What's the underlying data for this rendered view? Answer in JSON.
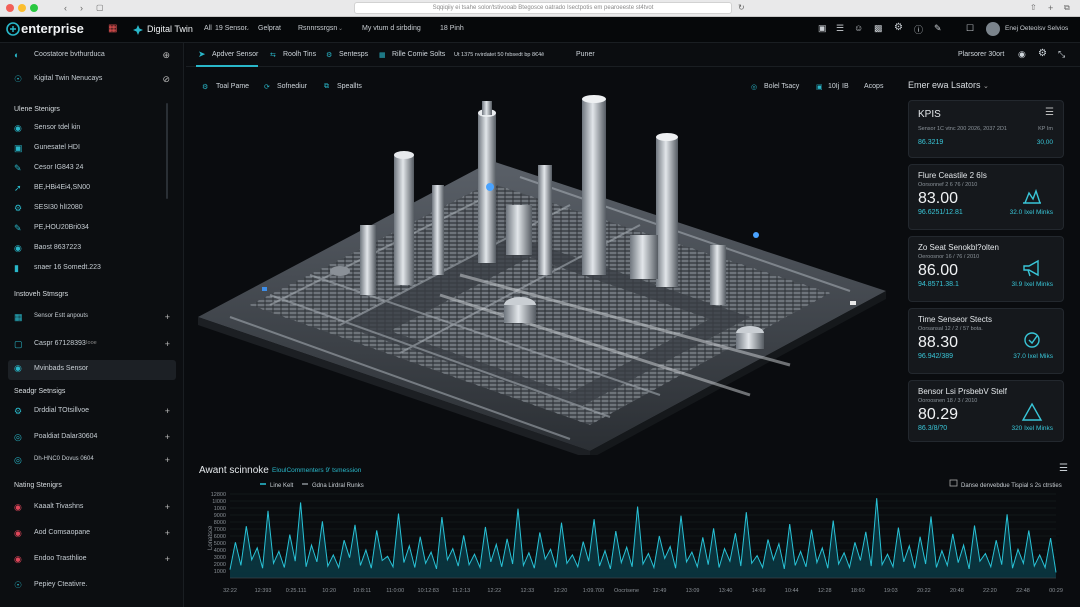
{
  "browser": {
    "url": "Sqqiqiiy ei tsahe solor/tstivooab Btegosce oatrado Isectpotis em pearoeeste st4tvot",
    "colors": {
      "close": "#f25f58",
      "min": "#fbbe2e",
      "max": "#29c840"
    }
  },
  "topbar": {
    "brand": "enterprise",
    "app_title": "Digital Twin",
    "menu": [
      "All",
      "19 Sensor",
      "Gelprat",
      "Rsnnrssrgsn",
      "My vtum d sirbding",
      "18 Pinh"
    ],
    "user_name": "Enej Oeteolsv Selvios",
    "icons": [
      "grid-icon",
      "camera-icon",
      "people-icon",
      "bag-icon",
      "gear-icon",
      "help-icon",
      "bell-icon",
      "layers-icon"
    ]
  },
  "sidebar": {
    "top_items": [
      {
        "label": "Coostatore bvthurduca"
      },
      {
        "label": "Kigital Twin Nenucays"
      }
    ],
    "section1_title": "Ulene Stenigrs",
    "section1_items": [
      {
        "label": "Sensor tdel kin"
      },
      {
        "label": "Gunesatel HDI"
      },
      {
        "label": "Cesor IG843 24"
      },
      {
        "label": "BE,HBi4Ei4,SN00"
      },
      {
        "label": "SESI30 hlI2080"
      },
      {
        "label": "PE,HOU20Bri034"
      },
      {
        "label": "Baost 8637223"
      },
      {
        "label": "snaer 16 Somedt.223"
      }
    ],
    "section2_title": "Instoveh Stmsgrs",
    "section2_items": [
      {
        "label": "Sensor Estt anpouts"
      },
      {
        "label": "Caspr 67128393",
        "tag": "Iooe"
      },
      {
        "label": "Mvinbads Sensor"
      }
    ],
    "section3_title": "Seadgr Setnsigs",
    "section3_items": [
      {
        "label": "Drddial TOtsillvoe"
      },
      {
        "label": "Poaldiat Dalar30604"
      },
      {
        "label": "Dh-HNC0 Dovus 0604"
      }
    ],
    "section4_title": "Nating Stenigrs",
    "section4_items": [
      {
        "label": "Kaaalt Tivashns"
      },
      {
        "label": "Aod Comsaopane"
      },
      {
        "label": "Endoo Trasthlioe"
      },
      {
        "label": "Pepiey Cteativre."
      }
    ]
  },
  "secbar": {
    "items": [
      "Apdver Sensor",
      "Roolh Tins",
      "Sentesps",
      "Rille Comie Solts",
      "Ut 1375 nvirdatet 50 fxbsedt bp 8€4ê",
      "Puner"
    ],
    "right_label": "Plarsorer 30ort"
  },
  "view": {
    "tools": [
      "Toal Pame",
      "Sofnediur",
      "Speallts"
    ],
    "right_tools": [
      "Bolel Tsacy",
      "10Ij",
      "IB",
      "Acops"
    ]
  },
  "right_panel": {
    "header": "Emer ewa Lsators",
    "kpis": {
      "title": "KPIS",
      "subtitle": "Sensor 1C vtnc 200 2026, 2037 2D1",
      "subtitle_right": "KP Im",
      "value": "86.3219",
      "value_right": "30,00"
    },
    "cards": [
      {
        "title": "Flure Ceastile 2 6Is",
        "subtitle": "Oorsonnef 2 6 76 / 2010",
        "value": "83.00",
        "sub": "96.6251/12.81",
        "right": "32.0 Ixel Minks",
        "icon": "plant-icon"
      },
      {
        "title": "Zo Seat Senokbl?olten",
        "subtitle": "Oeroosnor 16 / 76 / 2010",
        "value": "86.00",
        "sub": "94.8571.38.1",
        "right": "3I.9 Ixel Minks",
        "icon": "megaphone-icon"
      },
      {
        "title": "Time Senseor Stects",
        "subtitle": "Oorsansal 12 / 2 / 57 bota.",
        "value": "88.30",
        "sub": "96.942/389",
        "right": "37.0 Ixel Miks",
        "icon": "target-icon"
      },
      {
        "title": "Bensor Lsi PrsbebV Stelf",
        "subtitle": "Ooroosnen 18 / 3 / 2010",
        "value": "80.29",
        "sub": "86.3/8/?0",
        "right": "320 Ixel Minks",
        "icon": "alert-triangle-icon"
      }
    ]
  },
  "chart": {
    "title": "Awant scinnoke",
    "subtitle": "EloulCommenters 9' tsmession",
    "legend": [
      "Line Kelt",
      "Gdna Lirdral Runks"
    ],
    "right_label": "Danse denvebdue Tispial s 2s ctrsties",
    "ylabel": "Lonatsce",
    "colors": {
      "line": "#28c2d6",
      "fill": "#0b3a44",
      "axis": "#8a9096"
    }
  },
  "chart_data": {
    "type": "area",
    "title": "Awant scinnoke",
    "ylabel": "Lonatsce",
    "ylim": [
      0,
      12000
    ],
    "yticks": [
      1000,
      2000,
      3000,
      4000,
      5000,
      6000,
      7000,
      8000,
      9000,
      10000,
      11000,
      12000
    ],
    "ytick_labels": [
      "1000",
      "2000",
      "3000",
      "4000",
      "5000",
      "6000",
      "7000",
      "8000",
      "9000",
      "1000",
      "1I000",
      "12800"
    ],
    "xtick_labels": [
      "32:22",
      "12:393",
      "0:25.111",
      "10:20",
      "10:8:11",
      "11:0:00",
      "10:12:83",
      "11:2:13",
      "12:22",
      "12:33",
      "12:20",
      "1:09.700",
      "Oocrisene",
      "12:49",
      "13:09",
      "13:40",
      "14:69",
      "10:44",
      "12:28",
      "18:60",
      "19:03",
      "20:22",
      "20:48",
      "22:20",
      "22:48",
      "00:29"
    ],
    "series": [
      {
        "values": [
          1200,
          5100,
          1800,
          7400,
          2600,
          4300,
          1400,
          9600,
          2100,
          3800,
          1500,
          6200,
          2400,
          10800,
          1600,
          4700,
          2300,
          8100,
          1700,
          3300,
          1500,
          5400,
          2900,
          7600,
          1800,
          4000,
          1400,
          6800,
          2500,
          3100,
          1600,
          9200,
          2200,
          4600,
          1500,
          5900,
          2100,
          3700,
          1300,
          8700,
          2600,
          4200,
          1700,
          6100,
          1900,
          3400,
          1500,
          7300,
          2300,
          4800,
          1600,
          5600,
          2000,
          9900,
          1800,
          3600,
          1400,
          6500,
          2700,
          4100,
          1500,
          7900,
          2100,
          3300,
          1600,
          5200,
          2400,
          8400,
          1700,
          3900,
          1300,
          6700,
          2200,
          4400,
          1600,
          10200,
          2000,
          3500,
          1500,
          6000,
          2800,
          4500,
          1400,
          8900,
          2300,
          3700,
          1600,
          5800,
          1900,
          7100,
          1500,
          4200,
          2400,
          6400,
          1700,
          9400,
          2100,
          3200,
          1500,
          5500,
          2600,
          4900,
          1300,
          7700,
          1800,
          3800,
          1600,
          6900,
          2200,
          4300,
          1400,
          8200,
          2000,
          3600,
          1500,
          5100,
          2500,
          6600,
          1700,
          11400,
          1900,
          3400,
          1600,
          7200,
          2300,
          4600,
          1400,
          5900,
          2000,
          8800,
          1500,
          3900,
          1800,
          6300,
          2200,
          4700,
          1300,
          7500,
          2400,
          3500,
          1600,
          5400,
          1900,
          9100,
          1400,
          4100,
          2100,
          6800,
          1700,
          3300,
          1500,
          5700,
          800
        ]
      }
    ]
  }
}
